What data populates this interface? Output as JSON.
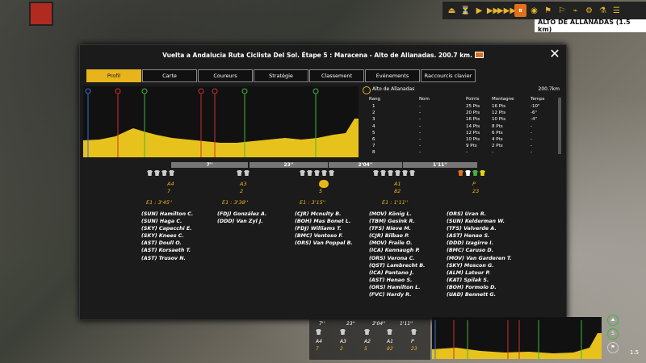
{
  "hud": {
    "stage_label": "ALTO DE ALLANADAS (1.5 km)",
    "buttons": [
      "⏏",
      "⏳",
      "▶",
      "▶▶",
      "▶▶▶",
      "⏸",
      "◉",
      "⚑",
      "⚐",
      "⌁",
      "⚙",
      "⚗",
      "☰"
    ]
  },
  "modal": {
    "title": "Vuelta a Andalucia Ruta Ciclista Del Sol. Étape 5 : Maracena - Alto de Allanadas. 200.7 km.",
    "close": "✕"
  },
  "tabs": [
    "Profil",
    "Carte",
    "Coureurs",
    "Stratégie",
    "Classement",
    "Evénements",
    "Raccourcis clavier"
  ],
  "climb": {
    "name": "Alto de Allanadas",
    "distance": "200.7km"
  },
  "rank_table": {
    "headers": [
      "Rang",
      "Nom",
      "Points",
      "Montagne",
      "Temps"
    ],
    "rows": [
      [
        "1",
        "-",
        "25 Pts",
        "16 Pts",
        "-10\""
      ],
      [
        "2",
        "-",
        "20 Pts",
        "12 Pts",
        "-6\""
      ],
      [
        "3",
        "-",
        "16 Pts",
        "10 Pts",
        "-4\""
      ],
      [
        "4",
        "-",
        "14 Pts",
        "8 Pts",
        "-"
      ],
      [
        "5",
        "-",
        "12 Pts",
        "6 Pts",
        "-"
      ],
      [
        "6",
        "-",
        "10 Pts",
        "4 Pts",
        "-"
      ],
      [
        "7",
        "-",
        "9 Pts",
        "2 Pts",
        "-"
      ],
      [
        "8",
        "-",
        "-",
        "-",
        "-"
      ]
    ]
  },
  "gaps": [
    "7''",
    "23''",
    "2'04''",
    "1'11''"
  ],
  "groups": [
    {
      "code": "A4",
      "count": "7",
      "time": "E1 : 3'45''",
      "riders": "(SUN) Hamilton C.\n(SUN) Haga C.\n(SKY) Capecchi E.\n(SKY) Knees C.\n(AST) Doull O.\n(AST) Korsaeth T.\n(AST) Trusov N."
    },
    {
      "code": "A3",
      "count": "2",
      "time": "E1 : 3'38''",
      "riders": "(FDJ) González A.\n(DDD) Van Zyl J."
    },
    {
      "code": "A2",
      "count": "5",
      "time": "E1 : 3'15''",
      "riders": "(CJR) Mcnulty B.\n(BOH) Mas Bonet L.\n(FDJ) Williams T.\n(BMC) Ventoso F.\n(ORS) Van Poppel B."
    },
    {
      "code": "A1",
      "count": "82",
      "time": "E1 : 1'11''",
      "riders": "(MOV) König L.\n(TBM) Gesink R.\n(TFS) Nieve M.\n(CJR) Bilbao P.\n(MOV) Fraile O.\n(ICA) Kennaugh P.\n(ORS) Verona C.\n(QST) Lambrecht B.\n(ICA) Pantano J.\n(AST) Henao S.\n(ORS) Hamilton L.\n(FVC) Hardy R."
    },
    {
      "code": "P",
      "count": "23",
      "time": "",
      "riders": "(ORS) Uran R.\n(SUN) Kelderman W.\n(TFS) Valverde A.\n(AST) Henao S.\n(DDD) Izagirre I.\n(BMC) Caruso D.\n(MOV) Van Garderen T.\n(SKY) Moscon G.\n(ALM) Latour P.\n(KAT) Spilak S.\n(BOH) Formolo D.\n(UAD) Bennett G."
    }
  ],
  "mini": {
    "gaps": [
      "7''",
      "23''",
      "2'04''",
      "1'11''"
    ],
    "codes": [
      "A4",
      "A3",
      "A2",
      "A1",
      "P"
    ],
    "counts": [
      "7",
      "2",
      "5",
      "82",
      "23"
    ],
    "zoom": "1.5"
  },
  "colors": {
    "accent": "#e8b41c",
    "orange": "#e0701c",
    "green": "#3cb83c",
    "red": "#d03030",
    "blue": "#3b6fd0"
  }
}
